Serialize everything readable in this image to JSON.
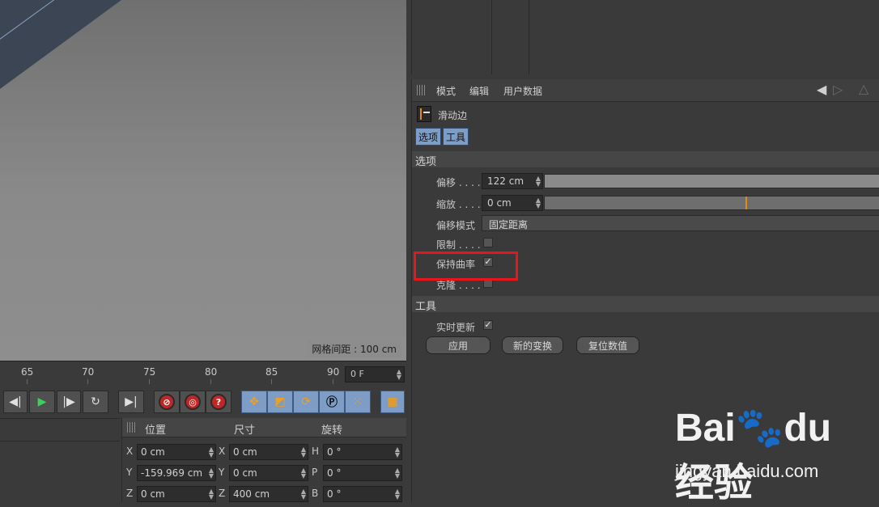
{
  "viewport": {
    "grid_label": "网格间距 : 100 cm"
  },
  "timeline": {
    "ticks": [
      "65",
      "70",
      "75",
      "80",
      "85",
      "90"
    ],
    "frame_value": "0 F"
  },
  "transport": {
    "buttons": [
      "go-prev-key",
      "play",
      "go-next-key",
      "loop",
      "go-end",
      "record-key",
      "auto-key",
      "help",
      "move",
      "scale",
      "rotate",
      "param",
      "dots",
      "film"
    ]
  },
  "coordinates": {
    "headers": {
      "position": "位置",
      "size": "尺寸",
      "rotation": "旋转"
    },
    "rows": [
      {
        "axis": "X",
        "pos": "0 cm",
        "size_axis": "X",
        "size": "0 cm",
        "rot_axis": "H",
        "rot": "0 °"
      },
      {
        "axis": "Y",
        "pos": "-159.969 cm",
        "size_axis": "Y",
        "size": "0 cm",
        "rot_axis": "P",
        "rot": "0 °"
      },
      {
        "axis": "Z",
        "pos": "0 cm",
        "size_axis": "Z",
        "size": "400 cm",
        "rot_axis": "B",
        "rot": "0 °"
      }
    ]
  },
  "attributes": {
    "menu": {
      "mode": "模式",
      "edit": "编辑",
      "user_data": "用户数据"
    },
    "tool_name": "滑动边",
    "tabs": {
      "options": "选项",
      "tool": "工具"
    },
    "section_options": "选项",
    "offset": {
      "label": "偏移 . . . .",
      "value": "122 cm",
      "fill_fraction": 1.0
    },
    "scale": {
      "label": "缩放 . . . .",
      "value": "0 cm",
      "marker_fraction": 0.6
    },
    "offset_mode": {
      "label": "偏移模式",
      "value": "固定距离"
    },
    "limit": {
      "label": "限制 . . . .",
      "checked": false
    },
    "keep_curvature": {
      "label": "保持曲率",
      "checked": true,
      "mark": "✓"
    },
    "clone": {
      "label": "克隆 . . . .",
      "checked": false
    },
    "section_tool": "工具",
    "realtime": {
      "label": "实时更新",
      "checked": true,
      "mark": "✓"
    },
    "buttons": {
      "apply": "应用",
      "new_transform": "新的变换",
      "reset_values": "复位数值"
    }
  },
  "watermark": {
    "logo": "Bai🐾du 经验",
    "url": "jingyan.baidu.com"
  },
  "colors": {
    "accent_blue": "#7d9cc6",
    "highlight_red": "#e8161b",
    "slider_orange": "#e38a1c"
  }
}
